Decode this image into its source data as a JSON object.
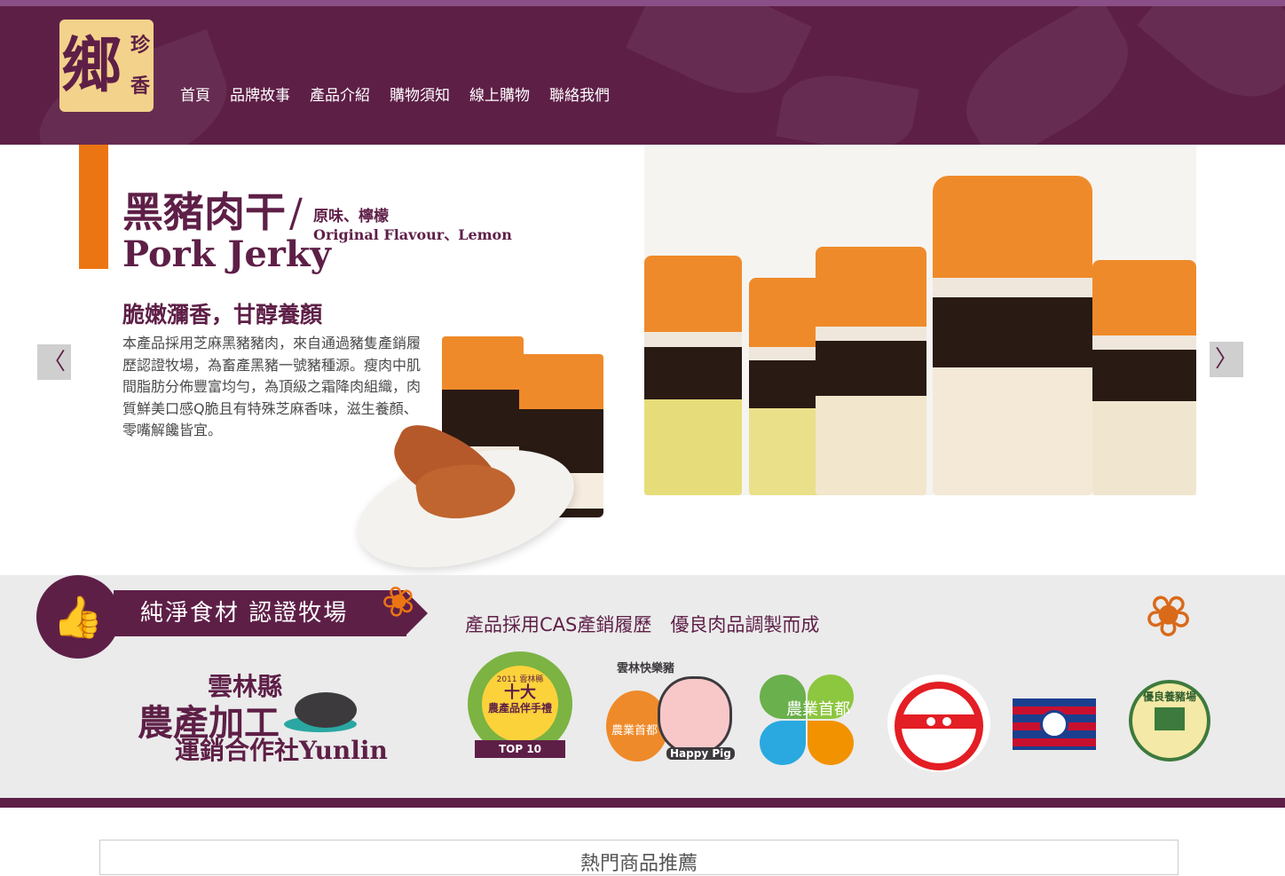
{
  "logo": {
    "main": "鄉",
    "side": "珍香"
  },
  "nav": {
    "items": [
      "首頁",
      "品牌故事",
      "產品介紹",
      "購物須知",
      "線上購物",
      "聯絡我們"
    ]
  },
  "slide": {
    "title_zh": "黑豬肉干",
    "slash": "/",
    "flavors_zh": "原味、檸檬",
    "flavors_en": "Original Flavour、Lemon",
    "title_en": "Pork Jerky",
    "subtitle": "脆嫩瀰香，甘醇養顏",
    "description": "本產品採用芝麻黑豬豬肉，來自通過豬隻產銷履歷認證牧場，為畜產黑豬一號豬種源。瘦肉中肌間脂肪分佈豐富均勻，為頂級之霜降肉組織，肉質鮮美口感Q脆且有特殊芝麻香味，滋生養顏、零嘴解饞皆宜。",
    "prev": "〈",
    "next": "〉"
  },
  "certification": {
    "banner": "純淨食材  認證牧場",
    "cas_text": "產品採用CAS產銷履歷　優良肉品調製而成",
    "coop": {
      "line1": "雲林縣",
      "line2": "農產加工",
      "line3_zh": "運銷合作社",
      "line3_en": "Yunlin"
    },
    "badges": {
      "top10": {
        "year": "2011 雲林縣",
        "main1": "十大",
        "main2": "農產品伴手禮",
        "ribbon": "TOP 10"
      },
      "happypig": {
        "top": "雲林快樂豬",
        "side": "農業首都",
        "tag": "Happy Pig"
      },
      "agri": {
        "text": "農業首都"
      },
      "farm": {
        "text": "優良養豬場"
      }
    }
  },
  "footer": {
    "box_title": "熱門商品推薦"
  },
  "colors": {
    "brand": "#5e1f47",
    "accent": "#ec7513",
    "gold": "#f3d28b"
  },
  "icons": {
    "thumb": "thumbs-up-icon",
    "wheat": "wheat-icon"
  }
}
